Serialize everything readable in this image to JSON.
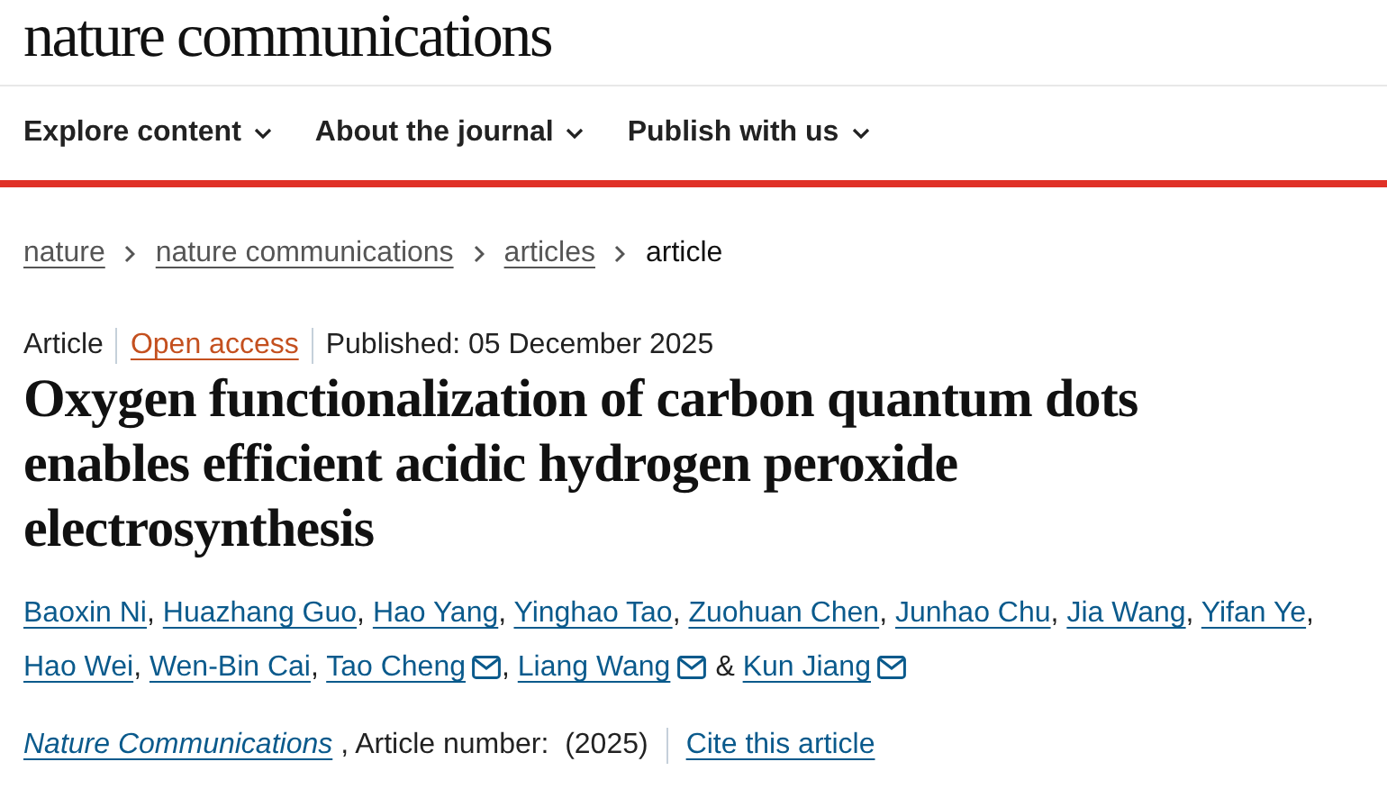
{
  "site": {
    "logo": "nature communications"
  },
  "nav": [
    {
      "label": "Explore content"
    },
    {
      "label": "About the journal"
    },
    {
      "label": "Publish with us"
    }
  ],
  "breadcrumbs": [
    {
      "label": "nature",
      "current": false
    },
    {
      "label": "nature communications",
      "current": false
    },
    {
      "label": "articles",
      "current": false
    },
    {
      "label": "article",
      "current": true
    }
  ],
  "meta": {
    "type": "Article",
    "access": "Open access",
    "published": "Published: 05 December 2025"
  },
  "title": "Oxygen functionalization of carbon quantum dots enables efficient acidic hydrogen peroxide electrosynthesis",
  "authors": [
    {
      "name": "Baoxin Ni",
      "corresponding": false,
      "after": ","
    },
    {
      "name": "Huazhang Guo",
      "corresponding": false,
      "after": ","
    },
    {
      "name": "Hao Yang",
      "corresponding": false,
      "after": ","
    },
    {
      "name": "Yinghao Tao",
      "corresponding": false,
      "after": ","
    },
    {
      "name": "Zuohuan Chen",
      "corresponding": false,
      "after": ","
    },
    {
      "name": "Junhao Chu",
      "corresponding": false,
      "after": ","
    },
    {
      "name": "Jia Wang",
      "corresponding": false,
      "after": ","
    },
    {
      "name": "Yifan Ye",
      "corresponding": false,
      "after": ","
    },
    {
      "name": "Hao Wei",
      "corresponding": false,
      "after": ","
    },
    {
      "name": "Wen-Bin Cai",
      "corresponding": false,
      "after": ","
    },
    {
      "name": "Tao Cheng",
      "corresponding": true,
      "after": ","
    },
    {
      "name": "Liang Wang",
      "corresponding": true,
      "after": "&"
    },
    {
      "name": "Kun Jiang",
      "corresponding": true
    }
  ],
  "citation": {
    "journal": "Nature Communications",
    "details": ", Article number:  (2025)",
    "cite_link": "Cite this article"
  }
}
